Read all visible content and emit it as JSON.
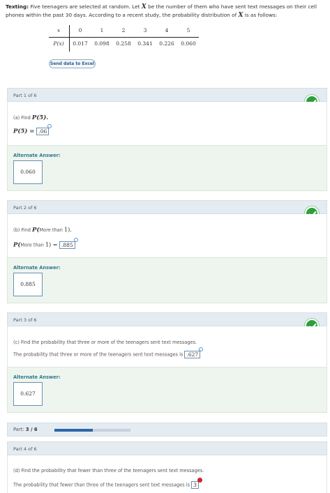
{
  "problem": {
    "lead": "Texting:",
    "text1": " Five teenagers are selected at random. Let ",
    "var1": "X",
    "text2": " be the number of them who have sent text messages on their cell phones within the past ",
    "days": "30",
    "text3": " days. According to a recent study, the probability distribution of ",
    "var2": "X",
    "text4": " is as follows:"
  },
  "table": {
    "row_x_label": "x",
    "row_p_label": "P(x)",
    "x_values": [
      "0",
      "1",
      "2",
      "3",
      "4",
      "5"
    ],
    "p_values": [
      "0.017",
      "0.098",
      "0.258",
      "0.341",
      "0.226",
      "0.060"
    ]
  },
  "excel_button": "Send data to Excel",
  "alt_label": "Alternate Answer:",
  "parts": [
    {
      "header": "Part 1 of 6",
      "question_prefix": "(a) Find ",
      "question_math": "P(5).",
      "answer_prefix": "P(5) = ",
      "answer": ".06",
      "alternate": "0.060"
    },
    {
      "header": "Part 2 of 6",
      "question_prefix": "(b) Find ",
      "question_math_p": "P(",
      "question_text": "More than ",
      "question_math_end": "1).",
      "answer_p": "P(",
      "answer_text": "More than ",
      "answer_end": "1) = ",
      "answer": ".885",
      "alternate": "0.885"
    },
    {
      "header": "Part 3 of 6",
      "question": "(c) Find the probability that three or more of the teenagers sent text messages.",
      "answer_prefix": "The probability that three or more of the teenagers sent text messages is ",
      "answer": ".627",
      "alternate": "0.627"
    },
    {
      "header": "Part 4 of 6",
      "question": "(d) Find the probability that fewer than three of the teenagers sent text messages.",
      "answer_prefix": "The probability that fewer than three of the teenagers sent text messages is ",
      "answer": "3"
    }
  ],
  "progress": {
    "label": "Part:",
    "value": "3 / 6",
    "fraction": 0.5
  },
  "colors": {
    "check_green": "#2e9e3e",
    "progress_blue": "#2b66a8",
    "alt_text": "#2f7a8a",
    "error_red": "#d2202f"
  }
}
